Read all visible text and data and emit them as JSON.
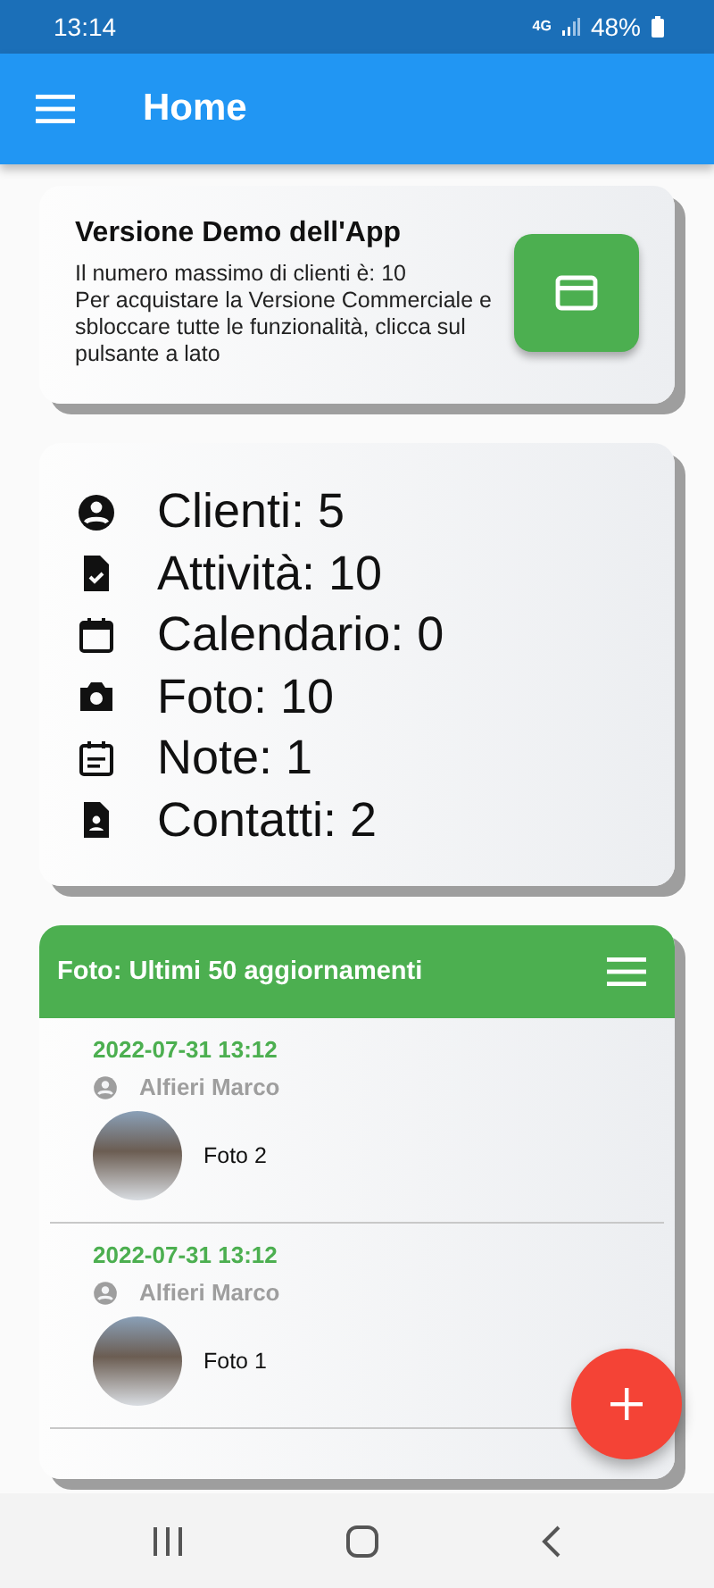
{
  "status_bar": {
    "time": "13:14",
    "network": "4G",
    "battery": "48%"
  },
  "app_bar": {
    "title": "Home"
  },
  "demo_card": {
    "title": "Versione Demo dell'App",
    "text": "Il numero massimo di clienti è: 10\nPer acquistare la Versione Commerciale e sbloccare tutte le funzionalità, clicca sul pulsante a lato"
  },
  "stats": [
    {
      "kind": "person",
      "label": "Clienti: 5"
    },
    {
      "kind": "task",
      "label": "Attività: 10"
    },
    {
      "kind": "calendar",
      "label": "Calendario: 0"
    },
    {
      "kind": "camera",
      "label": "Foto: 10"
    },
    {
      "kind": "note",
      "label": "Note: 1"
    },
    {
      "kind": "contact",
      "label": "Contatti: 2"
    }
  ],
  "updates": {
    "title": "Foto: Ultimi 50 aggiornamenti",
    "items": [
      {
        "date": "2022-07-31 13:12",
        "client": "Alfieri Marco",
        "photo": "Foto 2"
      },
      {
        "date": "2022-07-31 13:12",
        "client": "Alfieri Marco",
        "photo": "Foto 1"
      }
    ]
  }
}
